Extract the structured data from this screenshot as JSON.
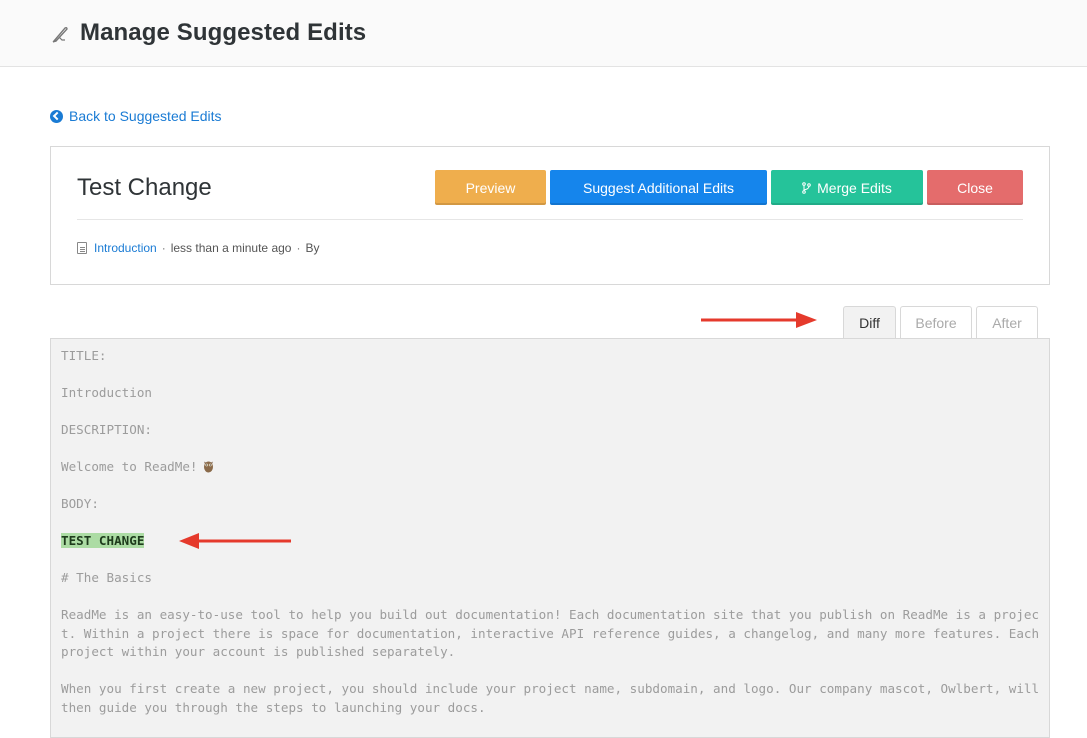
{
  "header": {
    "title": "Manage Suggested Edits",
    "icon": "quill-pen-icon"
  },
  "back_link": {
    "label": "Back to Suggested Edits",
    "icon": "circle-chevron-left-icon"
  },
  "edit": {
    "title": "Test Change",
    "buttons": {
      "preview": "Preview",
      "suggest": "Suggest Additional Edits",
      "merge": "Merge Edits",
      "close": "Close"
    },
    "meta": {
      "page_link": "Introduction",
      "time": "less than a minute ago",
      "by": "By",
      "separator": "·"
    }
  },
  "tabs": {
    "diff": "Diff",
    "before": "Before",
    "after": "After",
    "active": "Diff"
  },
  "diff": {
    "title_label": "TITLE:",
    "title_value": "Introduction",
    "description_label": "DESCRIPTION:",
    "description_value": "Welcome to ReadMe!",
    "body_label": "BODY:",
    "inserted": "TEST CHANGE",
    "heading": "# The Basics",
    "para1": "ReadMe is an easy-to-use tool to help you build out documentation! Each documentation site that you publish on ReadMe is a project. Within a project there is space for documentation, interactive API reference guides, a changelog, and many more features. Each project within your account is published separately.",
    "para2": "When you first create a new project, you should include your project name, subdomain, and logo. Our company mascot, Owlbert, will then guide you through the steps to launching your docs."
  },
  "colors": {
    "preview": "#efae4d",
    "suggest": "#1585ec",
    "merge": "#25c39a",
    "close": "#e46c6c",
    "link": "#1a7bd4",
    "inserted_bg": "#acdca4",
    "annotation_arrow": "#e53a2c"
  }
}
